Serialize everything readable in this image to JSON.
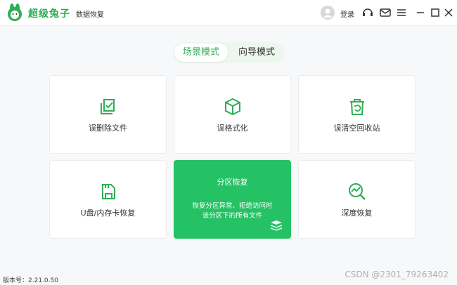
{
  "app": {
    "brand": "超级兔子",
    "subtitle": "数据恢复",
    "login": "登录"
  },
  "tabs": [
    {
      "label": "场景模式",
      "active": true
    },
    {
      "label": "向导模式",
      "active": false
    }
  ],
  "cards": [
    {
      "label": "误删除文件",
      "icon": "file-restore-icon"
    },
    {
      "label": "误格式化",
      "icon": "cube-icon"
    },
    {
      "label": "误清空回收站",
      "icon": "trash-restore-icon"
    },
    {
      "label": "U盘/内存卡恢复",
      "icon": "sd-card-icon"
    },
    {
      "title": "分区恢复",
      "desc_line1": "恢复分区异常、拒绝访问时",
      "desc_line2": "该分区下的所有文件",
      "icon": "partition-stack-icon"
    },
    {
      "label": "深度恢复",
      "icon": "chart-search-icon"
    }
  ],
  "footer": {
    "version": "版本号：2.21.0.50",
    "watermark": "CSDN @2301_79263402"
  },
  "colors": {
    "accent": "#2fae54",
    "card_green": "#24c264"
  }
}
